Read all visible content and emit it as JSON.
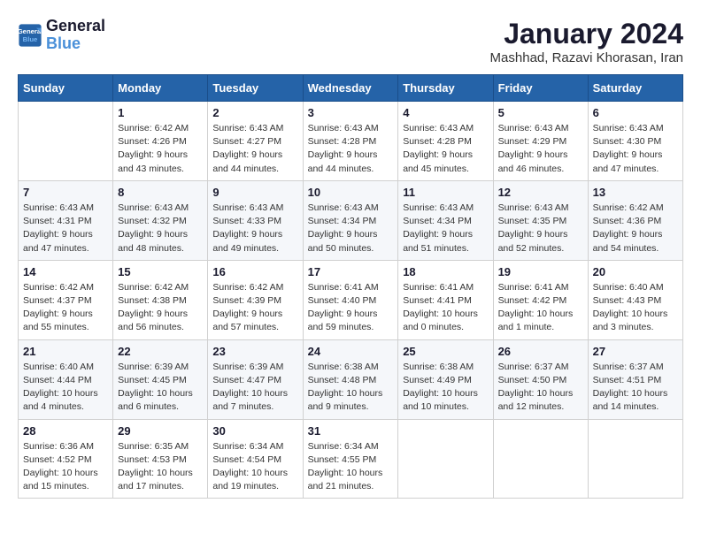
{
  "logo": {
    "line1": "General",
    "line2": "Blue"
  },
  "title": "January 2024",
  "location": "Mashhad, Razavi Khorasan, Iran",
  "weekdays": [
    "Sunday",
    "Monday",
    "Tuesday",
    "Wednesday",
    "Thursday",
    "Friday",
    "Saturday"
  ],
  "weeks": [
    [
      null,
      {
        "day": 1,
        "sunrise": "6:42 AM",
        "sunset": "4:26 PM",
        "daylight": "9 hours and 43 minutes."
      },
      {
        "day": 2,
        "sunrise": "6:43 AM",
        "sunset": "4:27 PM",
        "daylight": "9 hours and 44 minutes."
      },
      {
        "day": 3,
        "sunrise": "6:43 AM",
        "sunset": "4:28 PM",
        "daylight": "9 hours and 44 minutes."
      },
      {
        "day": 4,
        "sunrise": "6:43 AM",
        "sunset": "4:28 PM",
        "daylight": "9 hours and 45 minutes."
      },
      {
        "day": 5,
        "sunrise": "6:43 AM",
        "sunset": "4:29 PM",
        "daylight": "9 hours and 46 minutes."
      },
      {
        "day": 6,
        "sunrise": "6:43 AM",
        "sunset": "4:30 PM",
        "daylight": "9 hours and 47 minutes."
      }
    ],
    [
      {
        "day": 7,
        "sunrise": "6:43 AM",
        "sunset": "4:31 PM",
        "daylight": "9 hours and 47 minutes."
      },
      {
        "day": 8,
        "sunrise": "6:43 AM",
        "sunset": "4:32 PM",
        "daylight": "9 hours and 48 minutes."
      },
      {
        "day": 9,
        "sunrise": "6:43 AM",
        "sunset": "4:33 PM",
        "daylight": "9 hours and 49 minutes."
      },
      {
        "day": 10,
        "sunrise": "6:43 AM",
        "sunset": "4:34 PM",
        "daylight": "9 hours and 50 minutes."
      },
      {
        "day": 11,
        "sunrise": "6:43 AM",
        "sunset": "4:34 PM",
        "daylight": "9 hours and 51 minutes."
      },
      {
        "day": 12,
        "sunrise": "6:43 AM",
        "sunset": "4:35 PM",
        "daylight": "9 hours and 52 minutes."
      },
      {
        "day": 13,
        "sunrise": "6:42 AM",
        "sunset": "4:36 PM",
        "daylight": "9 hours and 54 minutes."
      }
    ],
    [
      {
        "day": 14,
        "sunrise": "6:42 AM",
        "sunset": "4:37 PM",
        "daylight": "9 hours and 55 minutes."
      },
      {
        "day": 15,
        "sunrise": "6:42 AM",
        "sunset": "4:38 PM",
        "daylight": "9 hours and 56 minutes."
      },
      {
        "day": 16,
        "sunrise": "6:42 AM",
        "sunset": "4:39 PM",
        "daylight": "9 hours and 57 minutes."
      },
      {
        "day": 17,
        "sunrise": "6:41 AM",
        "sunset": "4:40 PM",
        "daylight": "9 hours and 59 minutes."
      },
      {
        "day": 18,
        "sunrise": "6:41 AM",
        "sunset": "4:41 PM",
        "daylight": "10 hours and 0 minutes."
      },
      {
        "day": 19,
        "sunrise": "6:41 AM",
        "sunset": "4:42 PM",
        "daylight": "10 hours and 1 minute."
      },
      {
        "day": 20,
        "sunrise": "6:40 AM",
        "sunset": "4:43 PM",
        "daylight": "10 hours and 3 minutes."
      }
    ],
    [
      {
        "day": 21,
        "sunrise": "6:40 AM",
        "sunset": "4:44 PM",
        "daylight": "10 hours and 4 minutes."
      },
      {
        "day": 22,
        "sunrise": "6:39 AM",
        "sunset": "4:45 PM",
        "daylight": "10 hours and 6 minutes."
      },
      {
        "day": 23,
        "sunrise": "6:39 AM",
        "sunset": "4:47 PM",
        "daylight": "10 hours and 7 minutes."
      },
      {
        "day": 24,
        "sunrise": "6:38 AM",
        "sunset": "4:48 PM",
        "daylight": "10 hours and 9 minutes."
      },
      {
        "day": 25,
        "sunrise": "6:38 AM",
        "sunset": "4:49 PM",
        "daylight": "10 hours and 10 minutes."
      },
      {
        "day": 26,
        "sunrise": "6:37 AM",
        "sunset": "4:50 PM",
        "daylight": "10 hours and 12 minutes."
      },
      {
        "day": 27,
        "sunrise": "6:37 AM",
        "sunset": "4:51 PM",
        "daylight": "10 hours and 14 minutes."
      }
    ],
    [
      {
        "day": 28,
        "sunrise": "6:36 AM",
        "sunset": "4:52 PM",
        "daylight": "10 hours and 15 minutes."
      },
      {
        "day": 29,
        "sunrise": "6:35 AM",
        "sunset": "4:53 PM",
        "daylight": "10 hours and 17 minutes."
      },
      {
        "day": 30,
        "sunrise": "6:34 AM",
        "sunset": "4:54 PM",
        "daylight": "10 hours and 19 minutes."
      },
      {
        "day": 31,
        "sunrise": "6:34 AM",
        "sunset": "4:55 PM",
        "daylight": "10 hours and 21 minutes."
      },
      null,
      null,
      null
    ]
  ],
  "labels": {
    "sunrise_prefix": "Sunrise: ",
    "sunset_prefix": "Sunset: ",
    "daylight_prefix": "Daylight: "
  }
}
